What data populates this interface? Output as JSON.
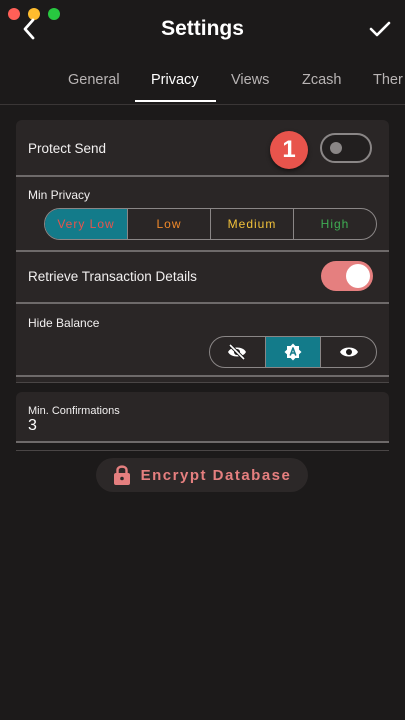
{
  "window": {
    "traffic_colors": [
      "#ff5f57",
      "#febc2e",
      "#28c840"
    ]
  },
  "header": {
    "title": "Settings",
    "back_icon": "chevron-left-icon",
    "confirm_icon": "check-icon"
  },
  "tabs": [
    {
      "label": "General",
      "active": false
    },
    {
      "label": "Privacy",
      "active": true
    },
    {
      "label": "Views",
      "active": false
    },
    {
      "label": "Zcash",
      "active": false
    },
    {
      "label": "Ther",
      "active": false
    }
  ],
  "protect_send": {
    "label": "Protect Send",
    "on": false,
    "badge": "1"
  },
  "min_privacy": {
    "label": "Min Privacy",
    "options": [
      {
        "label": "Very Low",
        "color": "#e8544c",
        "selected": true
      },
      {
        "label": "Low",
        "color": "#f0892a",
        "selected": false
      },
      {
        "label": "Medium",
        "color": "#f2c23a",
        "selected": false
      },
      {
        "label": "High",
        "color": "#3fae54",
        "selected": false
      }
    ]
  },
  "retrieve_tx": {
    "label": "Retrieve Transaction Details",
    "on": true
  },
  "hide_balance": {
    "label": "Hide Balance",
    "options": [
      {
        "icon": "eye-off-icon",
        "selected": false
      },
      {
        "icon": "auto-icon",
        "selected": true
      },
      {
        "icon": "eye-icon",
        "selected": false
      }
    ]
  },
  "min_confirmations": {
    "label": "Min. Confirmations",
    "value": "3"
  },
  "encrypt": {
    "label": "Encrypt Database",
    "icon": "lock-icon"
  },
  "colors": {
    "accent_teal": "#137b8a",
    "accent_pink": "#e57f7f",
    "badge_red": "#e8544c"
  }
}
